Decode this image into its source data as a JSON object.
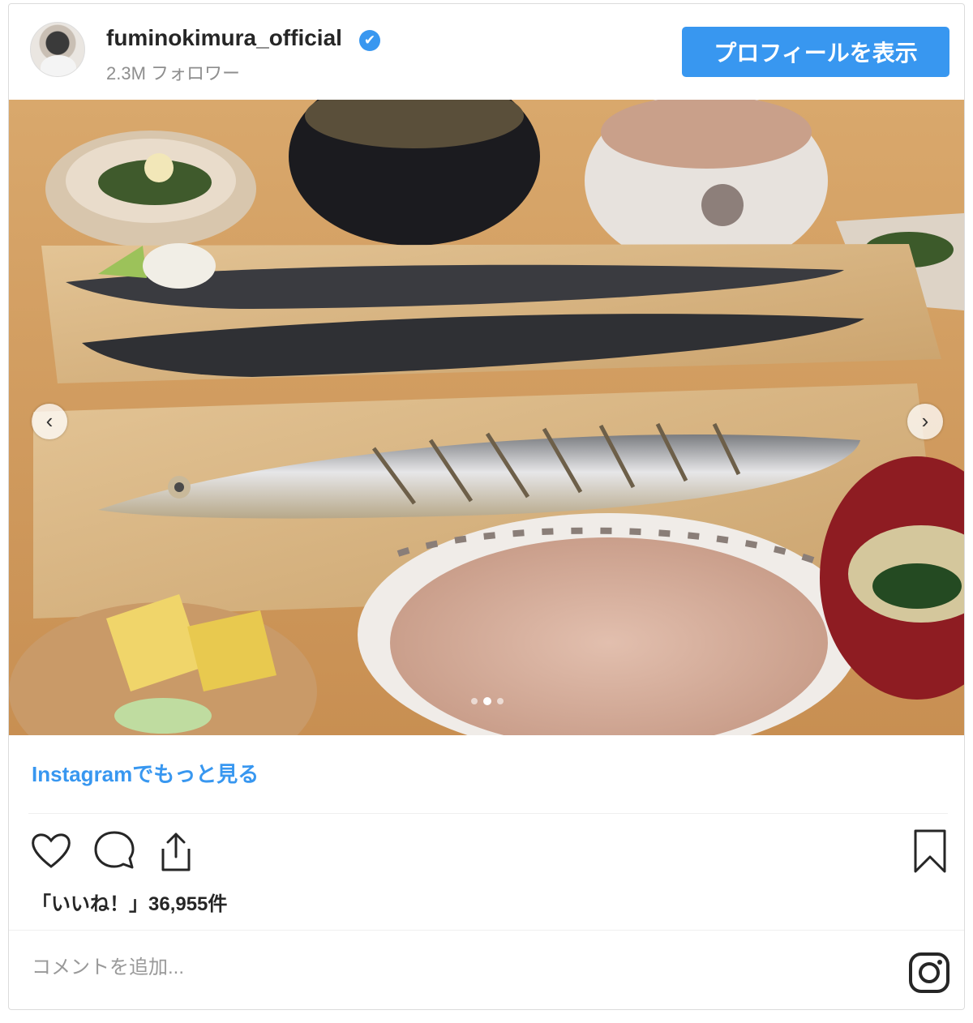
{
  "post": {
    "username": "fuminokimura_official",
    "verified_icon": "✔",
    "followers": "2.3M フォロワー",
    "profile_button": "プロフィールを表示",
    "more_link": "Instagramでもっと見る",
    "likes": "「いいね！」36,955件",
    "comment_placeholder": "コメントを追加...",
    "carousel": {
      "prev_arrow": "‹",
      "next_arrow": "›",
      "current_index": 2,
      "total": 3
    }
  },
  "icons": {
    "like": "heart-icon",
    "comment": "comment-bubble-icon",
    "share": "share-icon",
    "save": "bookmark-icon",
    "brand": "instagram-logo-icon"
  },
  "colors": {
    "accent": "#3897f0",
    "text": "#262626",
    "muted": "#8e8e8e"
  }
}
